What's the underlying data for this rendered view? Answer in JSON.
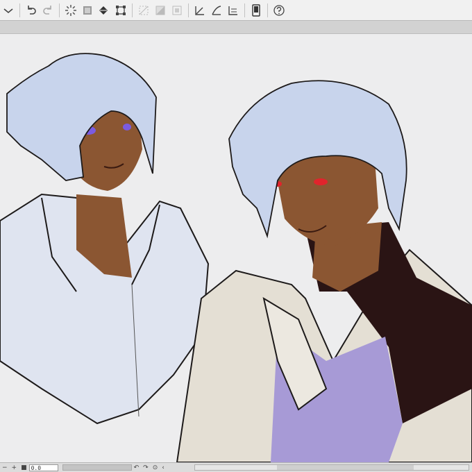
{
  "toolbar": {
    "buttons": [
      {
        "name": "dropdown-arrow-icon"
      },
      {
        "name": "undo-icon"
      },
      {
        "name": "redo-icon"
      },
      {
        "name": "loading-spinner-icon"
      },
      {
        "name": "clear-layer-icon"
      },
      {
        "name": "fill-icon"
      },
      {
        "name": "transform-icon"
      },
      {
        "name": "deselect-icon"
      },
      {
        "name": "invert-selection-icon"
      },
      {
        "name": "show-selection-icon"
      },
      {
        "name": "ruler-snap-icon"
      },
      {
        "name": "special-ruler-snap-icon"
      },
      {
        "name": "grid-snap-icon"
      },
      {
        "name": "device-icon"
      },
      {
        "name": "help-icon"
      }
    ]
  },
  "canvas": {
    "background": "#ededee",
    "colors": {
      "hair": "#c8d4ec",
      "skin": "#8b5632",
      "shirt_left": "#dfe4f0",
      "jacket": "#e4dfd4",
      "turtleneck": "#2a1414",
      "inner_shirt": "#a79ad6",
      "eye_left": "#7b5be0",
      "eye_right": "#e0242c",
      "line": "#1d1a1a"
    }
  },
  "statusbar": {
    "zoom": "0.0"
  }
}
